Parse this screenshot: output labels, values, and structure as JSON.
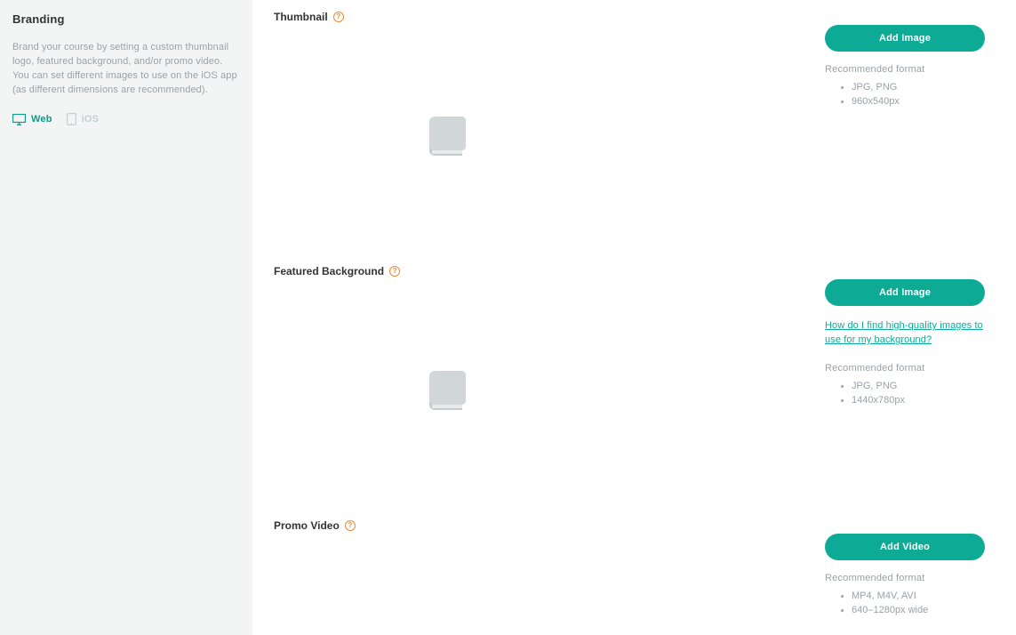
{
  "sidebar": {
    "title": "Branding",
    "description": "Brand your course by setting a custom thumbnail logo, featured background, and/or promo video. You can set different images to use on the iOS app (as different dimensions are recommended).",
    "tabs": [
      {
        "label": "Web",
        "active": true
      },
      {
        "label": "iOS",
        "active": false
      }
    ]
  },
  "sections": {
    "thumbnail": {
      "title": "Thumbnail",
      "button": "Add Image",
      "recommended_title": "Recommended format",
      "recommended": [
        "JPG, PNG",
        "960x540px"
      ]
    },
    "featured": {
      "title": "Featured Background",
      "button": "Add Image",
      "help_link": "How do I find high-quality images to use for my background?",
      "recommended_title": "Recommended format",
      "recommended": [
        "JPG, PNG",
        "1440x780px"
      ]
    },
    "promo": {
      "title": "Promo Video",
      "button": "Add Video",
      "recommended_title": "Recommended format",
      "recommended": [
        "MP4, M4V, AVI",
        "640–1280px wide"
      ]
    }
  }
}
